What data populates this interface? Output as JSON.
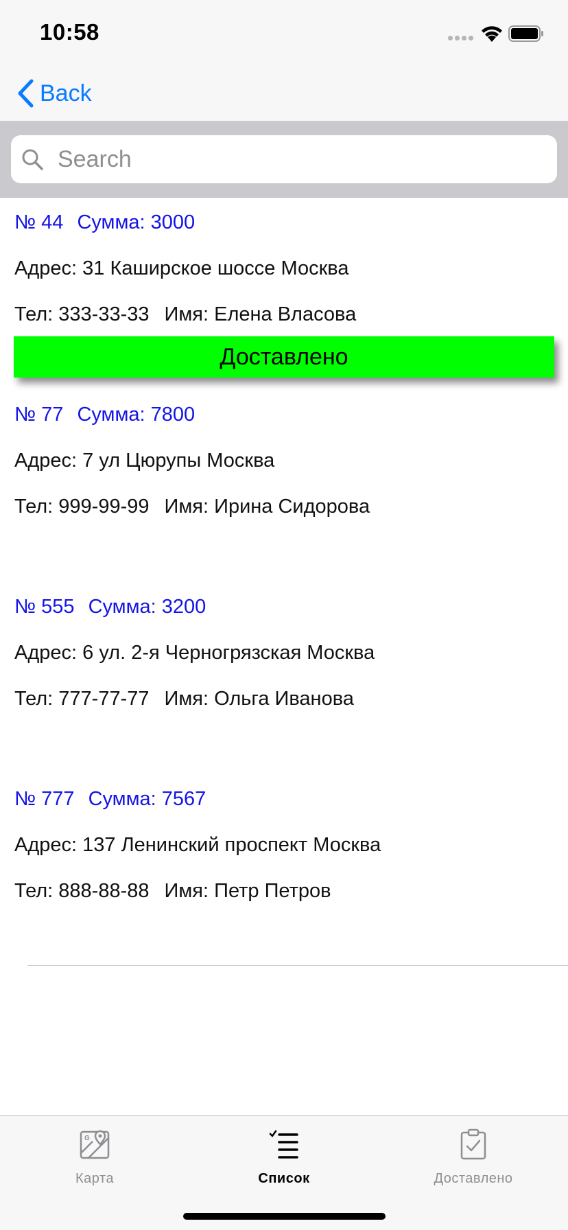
{
  "status_bar": {
    "time": "10:58"
  },
  "nav": {
    "back_label": "Back"
  },
  "search": {
    "placeholder": "Search",
    "value": ""
  },
  "orders": [
    {
      "number": "№ 44",
      "sum": "Сумма: 3000",
      "address": "Адрес: 31 Каширское шоссе Москва",
      "phone": "Тел: 333-33-33",
      "name": "Имя: Елена Власова"
    },
    {
      "number": "№ 77",
      "sum": "Сумма: 7800",
      "address": "Адрес: 7 ул Цюрупы Москва",
      "phone": "Тел: 999-99-99",
      "name": "Имя: Ирина Сидорова"
    },
    {
      "number": "№ 555",
      "sum": "Сумма: 3200",
      "address": "Адрес: 6 ул. 2-я Черногрязская Москва",
      "phone": "Тел: 777-77-77",
      "name": "Имя: Ольга Иванова"
    },
    {
      "number": "№ 777",
      "sum": "Сумма: 7567",
      "address": "Адрес: 137 Ленинский проспект Москва",
      "phone": "Тел: 888-88-88",
      "name": "Имя: Петр Петров"
    }
  ],
  "delivered_button": {
    "label": "Доставлено",
    "color": "#00ff00"
  },
  "tabs": [
    {
      "label": "Карта",
      "icon": "map-icon",
      "active": false
    },
    {
      "label": "Список",
      "icon": "list-icon",
      "active": true
    },
    {
      "label": "Доставлено",
      "icon": "clipboard-check-icon",
      "active": false
    }
  ],
  "colors": {
    "accent": "#0a7aff",
    "order_header": "#1414e6",
    "tab_inactive": "#8e8e93"
  }
}
